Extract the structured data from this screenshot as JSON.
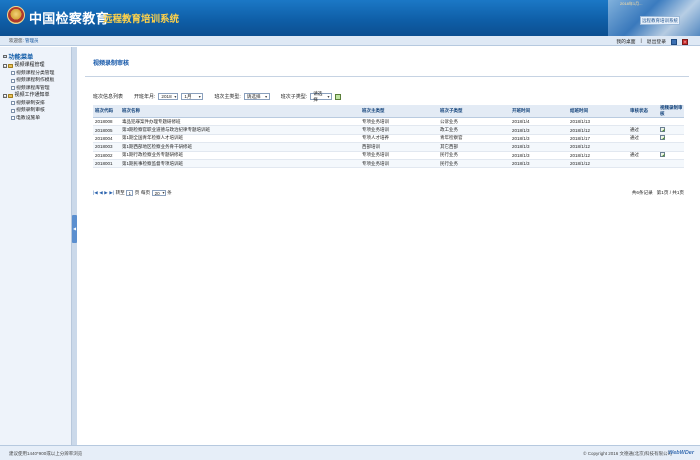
{
  "header": {
    "title": "中国检察教育",
    "subtitle": "远程教育培训系统",
    "date_text": "2018年1月...",
    "system_badge": "远程教育培训系统"
  },
  "topbar": {
    "welcome_label": "欢迎您:",
    "user": "管理员",
    "return_home": "我的桌面",
    "separator": "|",
    "logout": "退出登录"
  },
  "sidebar": {
    "title": "功能菜单",
    "groups": [
      {
        "label": "视频课程管理",
        "items": [
          "视频课程分类管理",
          "视频课程制作模板",
          "视频课程库管理"
        ]
      },
      {
        "label": "视频工作通知单",
        "items": [
          "视频录制安排",
          "视频录制审核",
          "电教设施单"
        ]
      }
    ]
  },
  "main": {
    "heading": "视频录制审核",
    "filters": {
      "list_label": "班次信息列表",
      "year_month_label": "开班年月:",
      "year": "2018",
      "month": "1月",
      "main_type_label": "班次主类型:",
      "main_type_value": "请选择",
      "sub_type_label": "班次子类型:",
      "sub_type_value": "请选择"
    },
    "table": {
      "columns": [
        "班次代码",
        "班次名称",
        "班次主类型",
        "班次子类型",
        "开班时间",
        "结班时间",
        "审核状态",
        "视频录制审核"
      ],
      "rows": [
        {
          "code": "2018008",
          "name": "毒品犯罪案件办理专题研修班",
          "main_type": "专项业务培训",
          "sub_type": "公诉业务",
          "start": "2018/1/4",
          "end": "2018/1/13",
          "status": "",
          "edit": false
        },
        {
          "code": "2018005",
          "name": "第3期检察官职业道德与政治纪律专题培训班",
          "main_type": "专项业务培训",
          "sub_type": "政工业务",
          "start": "2018/1/3",
          "end": "2018/1/12",
          "status": "通过",
          "edit": true
        },
        {
          "code": "2018004",
          "name": "第1期全国青年检察人才培训班",
          "main_type": "专项人才培养",
          "sub_type": "青年检察官",
          "start": "2018/1/3",
          "end": "2018/1/17",
          "status": "通过",
          "edit": true
        },
        {
          "code": "2018003",
          "name": "第1期西部地区检察业务骨干研修班",
          "main_type": "西部培训",
          "sub_type": "其它西部",
          "start": "2018/1/3",
          "end": "2018/1/12",
          "status": "",
          "edit": false
        },
        {
          "code": "2018002",
          "name": "第1期行政检察业务专题研修班",
          "main_type": "专项业务培训",
          "sub_type": "民行业务",
          "start": "2018/1/3",
          "end": "2018/1/12",
          "status": "通过",
          "edit": true
        },
        {
          "code": "2018001",
          "name": "第1期民事检察监督专项培训班",
          "main_type": "专项业务培训",
          "sub_type": "民行业务",
          "start": "2018/1/3",
          "end": "2018/1/12",
          "status": "",
          "edit": false
        }
      ]
    },
    "pager": {
      "first": "|◀",
      "prev": "◀",
      "next": "▶",
      "last": "▶|",
      "page_label_before": "转至",
      "page_value": "1",
      "page_label_after": "页",
      "per_page_label": "每页",
      "per_page_value": "20",
      "per_page_unit": "条",
      "total_records": "共6条记录",
      "page_info": "第1页 / 共1页"
    }
  },
  "footer": {
    "left": "建议使用1440*900或以上分辨率浏览",
    "right": "© Copyright 2016 文德通(北京)科技有限公司",
    "brand": "WebWDer"
  }
}
